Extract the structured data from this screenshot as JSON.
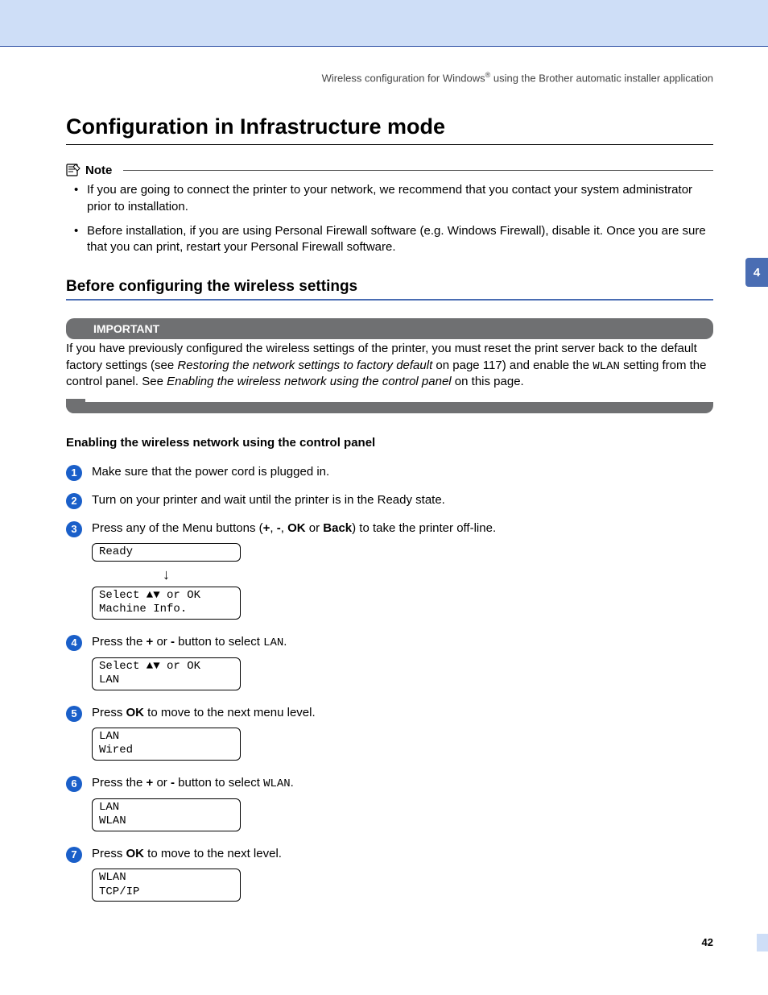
{
  "header": {
    "running_left": "Wireless configuration for Windows",
    "running_sup": "®",
    "running_right": " using the Brother automatic installer application"
  },
  "title": "Configuration in Infrastructure mode",
  "note": {
    "label": "Note",
    "items": [
      "If you are going to connect the printer to your network, we recommend that you contact your system administrator prior to installation.",
      "Before installation, if you are using Personal Firewall software (e.g. Windows Firewall), disable it. Once you are sure that you can print, restart your Personal Firewall software."
    ]
  },
  "section2": "Before configuring the wireless settings",
  "important": {
    "label": "IMPORTANT",
    "pre": "If you have previously configured the wireless settings of the printer, you must reset the print server back to the default factory settings (see ",
    "ref1": "Restoring the network settings to factory default",
    "mid1": " on page 117) and enable the ",
    "mono": "WLAN",
    "mid2": " setting from the control panel. See ",
    "ref2": "Enabling the wireless network using the control panel",
    "post": " on this page."
  },
  "section3": "Enabling the wireless network using the control panel",
  "steps": {
    "s1": "Make sure that the power cord is plugged in.",
    "s2": "Turn on your printer and wait until the printer is in the Ready state.",
    "s3_pre": "Press any of the Menu buttons (",
    "s3_b1": "+",
    "s3_c1": ", ",
    "s3_b2": "-",
    "s3_c2": ", ",
    "s3_b3": "OK",
    "s3_c3": " or ",
    "s3_b4": "Back",
    "s3_post": ") to take the printer off-line.",
    "lcd3a": "Ready",
    "lcd3b_line1": "Select ▲▼ or OK",
    "lcd3b_line2": "Machine Info.",
    "s4_pre": "Press the ",
    "s4_b1": "+",
    "s4_mid": " or ",
    "s4_b2": "-",
    "s4_post": " button to select ",
    "s4_mono": "LAN",
    "s4_end": ".",
    "lcd4_line1": "Select ▲▼ or OK",
    "lcd4_line2": "LAN",
    "s5_pre": "Press ",
    "s5_b": "OK",
    "s5_post": " to move to the next menu level.",
    "lcd5_line1": "LAN",
    "lcd5_line2": "Wired",
    "s6_pre": "Press the ",
    "s6_b1": "+",
    "s6_mid": " or ",
    "s6_b2": "-",
    "s6_post": " button to select ",
    "s6_mono": "WLAN",
    "s6_end": ".",
    "lcd6_line1": "LAN",
    "lcd6_line2": "WLAN",
    "s7_pre": "Press ",
    "s7_b": "OK",
    "s7_post": " to move to the next level.",
    "lcd7_line1": "WLAN",
    "lcd7_line2": "TCP/IP"
  },
  "sidetab": "4",
  "pagenum": "42"
}
